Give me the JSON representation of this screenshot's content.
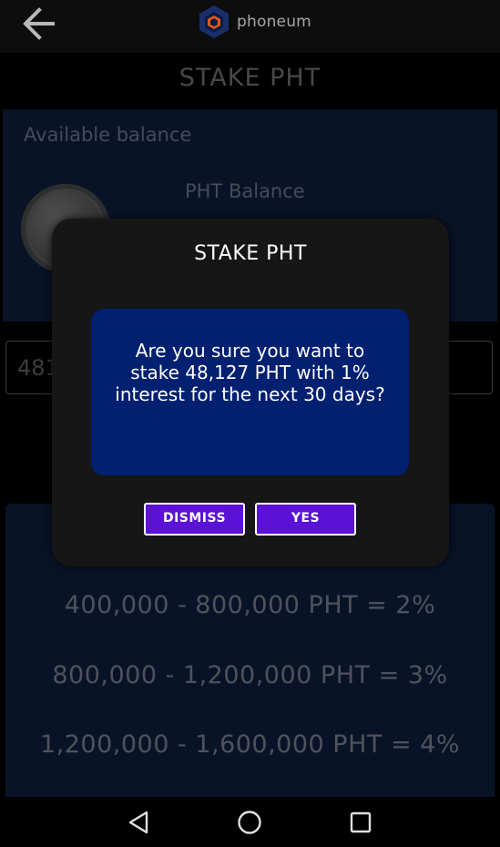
{
  "header": {
    "back_icon": "arrow-left-icon",
    "logo_text": "phoneum",
    "title": "STAKE PHT"
  },
  "balance": {
    "available_label": "Available balance",
    "pht_label": "PHT Balance"
  },
  "amount_input": {
    "value": "48127"
  },
  "tiers": [
    "400,000 - 800,000 PHT = 2%",
    "800,000 - 1,200,000 PHT = 3%",
    "1,200,000 - 1,600,000 PHT = 4%"
  ],
  "dialog": {
    "title": "STAKE PHT",
    "message": "Are you sure you want to stake 48,127 PHT with 1% interest for the next 30 days?",
    "dismiss_label": "DISMISS",
    "yes_label": "YES"
  },
  "navbar": {
    "back_icon": "triangle-back-icon",
    "home_icon": "circle-home-icon",
    "recents_icon": "square-recents-icon"
  },
  "colors": {
    "panel_bg": "#0f1e3e",
    "dialog_bg": "#161616",
    "dialog_body_bg": "#012070",
    "button_bg": "#5b11d6"
  }
}
